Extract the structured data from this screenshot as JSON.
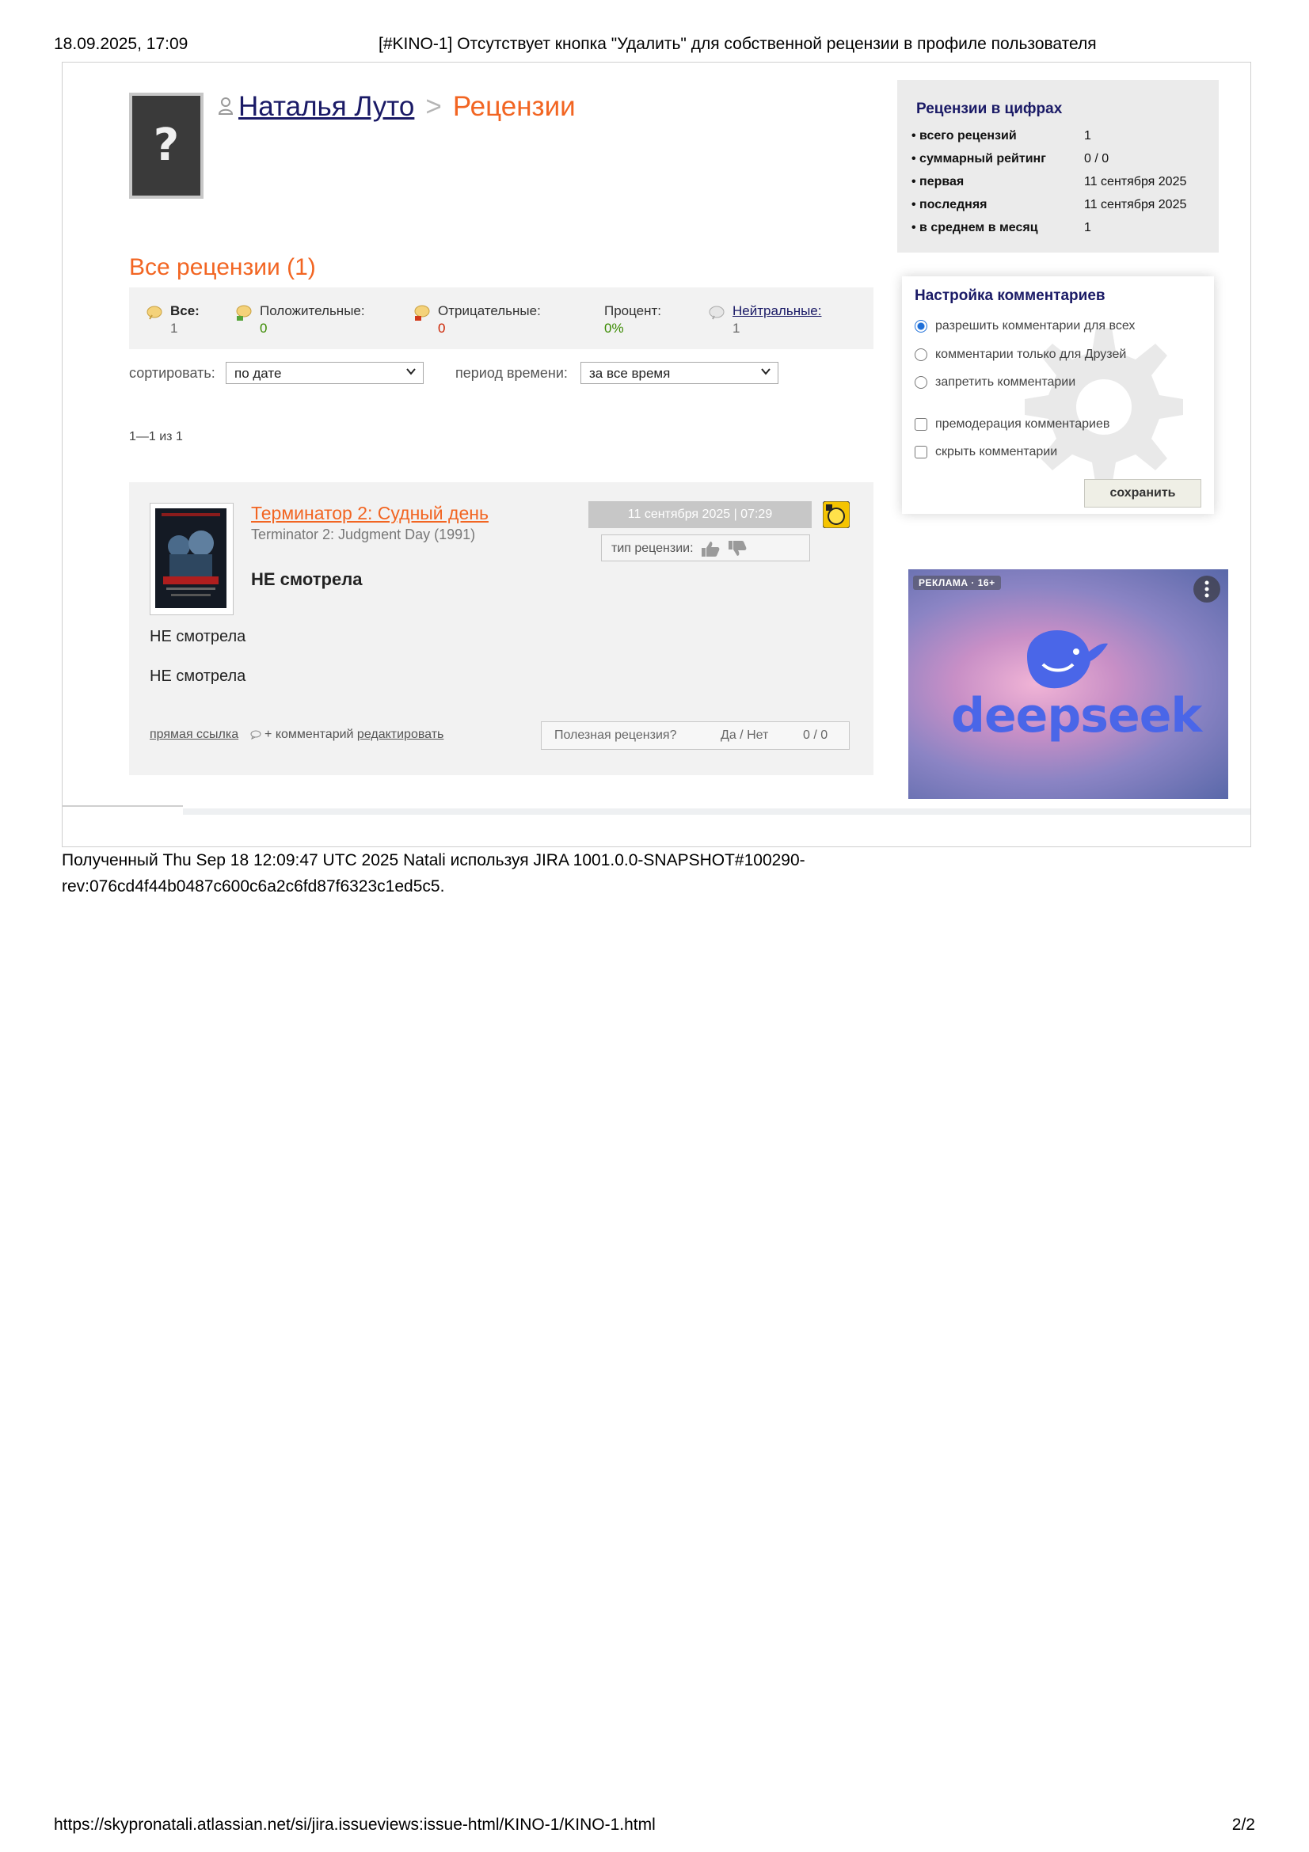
{
  "page_header": {
    "date": "18.09.2025, 17:09",
    "title": "[#KINO-1] Отсутствует кнопка \"Удалить\" для собственной рецензии в профиле пользователя"
  },
  "page_footer": {
    "url": "https://skypronatali.atlassian.net/si/jira.issueviews:issue-html/KINO-1/KINO-1.html",
    "page": "2/2"
  },
  "generated_note": "Полученный Thu Sep 18 12:09:47 UTC 2025 Natali используя JIRA 1001.0.0-SNAPSHOT#100290-rev:076cd4f44b0487c600c6a2c6fd87f6323c1ed5c5.",
  "profile": {
    "avatar_glyph": "?",
    "user_name": "Наталья Луто",
    "separator": ">",
    "section": "Рецензии"
  },
  "reviews": {
    "title": "Все рецензии (1)",
    "filters": {
      "all": {
        "label": "Все:",
        "value": "1"
      },
      "positive": {
        "label": "Положительные:",
        "value": "0"
      },
      "negative": {
        "label": "Отрицательные:",
        "value": "0"
      },
      "percent": {
        "label": "Процент:",
        "value": "0%"
      },
      "neutral": {
        "label": "Нейтральные:",
        "value": "1"
      }
    },
    "sort_label": "сортировать:",
    "sort_value": "по дате",
    "period_label": "период времени:",
    "period_value": "за все время",
    "pager": "1—1 из 1",
    "items": [
      {
        "title": "Терминатор 2: Судный день",
        "original_title": "Terminator 2: Judgment Day (1991)",
        "headline": "НЕ смотрела",
        "body_lines": [
          "НЕ смотрела",
          "НЕ смотрела"
        ],
        "date": "11 сентября 2025 | 07:29",
        "type_label": "тип рецензии:",
        "direct_link": "прямая ссылка",
        "add_comment": "+ комментарий",
        "edit": "редактировать",
        "useful_label": "Полезная рецензия?",
        "useful_yes_no": "Да / Нет",
        "useful_count": "0 / 0",
        "poster_caption": "ТЕРМИНАТОР 2"
      }
    ]
  },
  "stats": {
    "title": "Рецензии в цифрах",
    "rows": [
      {
        "key": "• всего рецензий",
        "value": "1"
      },
      {
        "key": "• суммарный рейтинг",
        "value": "0 / 0"
      },
      {
        "key": "• первая",
        "value": "11 сентября 2025"
      },
      {
        "key": "• последняя",
        "value": "11 сентября 2025"
      },
      {
        "key": "• в среднем в месяц",
        "value": "1"
      }
    ]
  },
  "comment_settings": {
    "title": "Настройка комментариев",
    "options": [
      {
        "label": "разрешить комментарии для всех",
        "selected": true
      },
      {
        "label": "комментарии только для Друзей",
        "selected": false
      },
      {
        "label": "запретить комментарии",
        "selected": false
      }
    ],
    "checkboxes": [
      {
        "label": "премодерация комментариев",
        "checked": false
      },
      {
        "label": "скрыть комментарии",
        "checked": false
      }
    ],
    "save_label": "сохранить"
  },
  "ad": {
    "tag": "РЕКЛАМА · 16+",
    "brand": "deepseek"
  },
  "colors": {
    "accent_orange": "#f26522",
    "link_navy": "#1a1a66",
    "panel_gray": "#f2f2f2"
  }
}
